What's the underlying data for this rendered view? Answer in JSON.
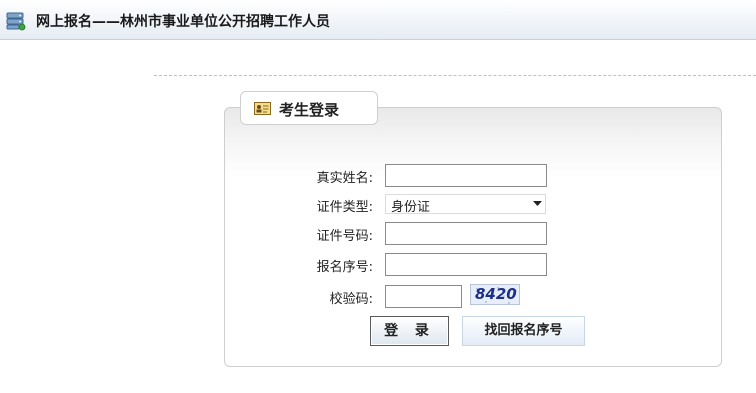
{
  "header": {
    "title": "网上报名——林州市事业单位公开招聘工作人员",
    "icon": "server-icon"
  },
  "panel": {
    "title": "考生登录",
    "icon": "id-card-icon"
  },
  "form": {
    "name_label": "真实姓名:",
    "name_value": "",
    "id_type_label": "证件类型:",
    "id_type_value": "身份证",
    "id_number_label": "证件号码:",
    "id_number_value": "",
    "reg_number_label": "报名序号:",
    "reg_number_value": "",
    "captcha_label": "校验码:",
    "captcha_value": "",
    "captcha_text": "8420"
  },
  "buttons": {
    "login_label": "登 录",
    "find_label": "找回报名序号"
  },
  "colors": {
    "header_bg": "#e6ecf3",
    "captcha_text": "#1c2f8e",
    "border": "#cfcfcf"
  }
}
